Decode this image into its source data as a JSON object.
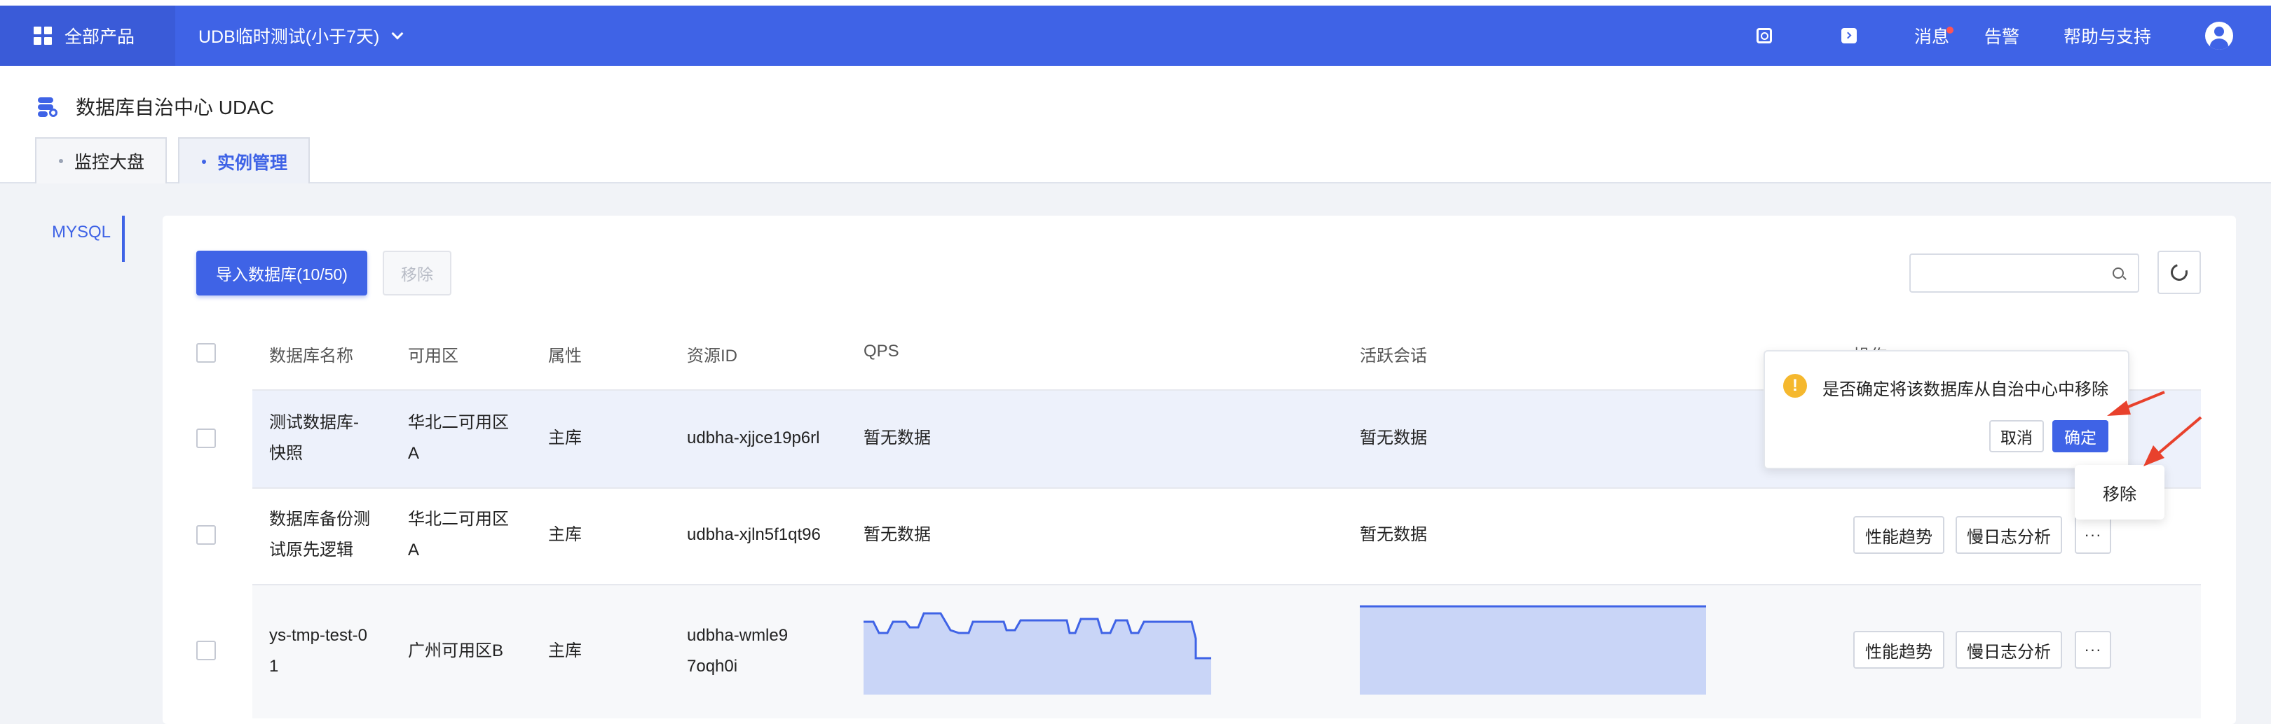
{
  "topbar": {
    "all_products": "全部产品",
    "project": "UDB临时测试(小于7天)",
    "messages": "消息",
    "alarms": "告警",
    "help": "帮助与支持"
  },
  "app": {
    "title": "数据库自治中心 UDAC",
    "tabs": [
      "监控大盘",
      "实例管理"
    ],
    "active_tab": "实例管理"
  },
  "sidebar": {
    "items": [
      "MYSQL"
    ]
  },
  "toolbar": {
    "import_label": "导入数据库(10/50)",
    "remove_label": "移除",
    "search_placeholder": ""
  },
  "table": {
    "headers": [
      "数据库名称",
      "可用区",
      "属性",
      "资源ID",
      "QPS",
      "活跃会话",
      "操作"
    ],
    "rows": [
      {
        "name": "测试数据库-快照",
        "zone": "华北二可用区A",
        "role": "主库",
        "resource_id": "udbha-xjjce19p6rl",
        "qps": "暂无数据",
        "sessions": "暂无数据"
      },
      {
        "name": "数据库备份测试原先逻辑",
        "zone": "华北二可用区A",
        "role": "主库",
        "resource_id": "udbha-xjln5f1qt96",
        "qps": "暂无数据",
        "sessions": "暂无数据",
        "actions": [
          "性能趋势",
          "慢日志分析"
        ]
      },
      {
        "name": "ys-tmp-test-01",
        "zone": "广州可用区B",
        "role": "主库",
        "resource_id": "udbha-wmle97oqh0i",
        "actions": [
          "性能趋势",
          "慢日志分析"
        ]
      }
    ]
  },
  "popconfirm": {
    "message": "是否确定将该数据库从自治中心中移除",
    "cancel": "取消",
    "confirm": "确定"
  },
  "more_menu": {
    "items": [
      "移除"
    ]
  },
  "colors": {
    "primary": "#3f63e6",
    "sparkline_fill": "#c9d5f7",
    "annotation_arrow": "#e8412c",
    "warning": "#f5b82e"
  }
}
